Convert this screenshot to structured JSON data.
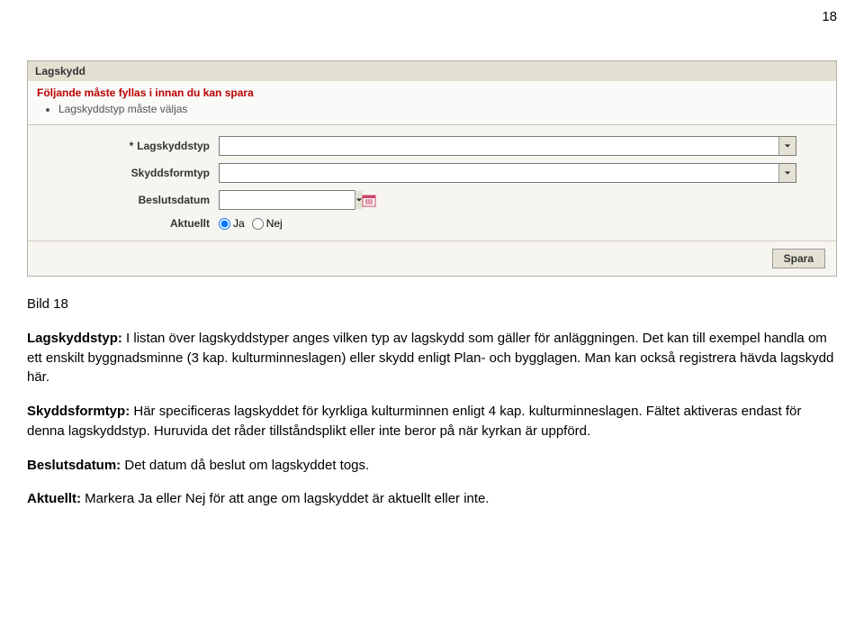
{
  "page_number": "18",
  "panel": {
    "title": "Lagskydd",
    "validation": {
      "title": "Följande måste fyllas i innan du kan spara",
      "items": [
        "Lagskyddstyp måste väljas"
      ]
    },
    "fields": {
      "lagskyddstyp": {
        "label": "Lagskyddstyp",
        "required": "*",
        "value": ""
      },
      "skyddsformtyp": {
        "label": "Skyddsformtyp",
        "value": ""
      },
      "beslutsdatum": {
        "label": "Beslutsdatum",
        "value": ""
      },
      "aktuellt": {
        "label": "Aktuellt",
        "ja": "Ja",
        "nej": "Nej"
      }
    },
    "save": "Spara"
  },
  "body": {
    "caption": "Bild 18",
    "p1_label": "Lagskyddstyp:",
    "p1_text": " I listan över lagskyddstyper anges vilken typ av lagskydd som gäller för anläggningen. Det kan till exempel handla om ett enskilt byggnadsminne (3 kap. kulturminneslagen) eller skydd enligt Plan- och bygglagen. Man kan också registrera hävda lagskydd här.",
    "p2_label": "Skyddsformtyp:",
    "p2_text": " Här specificeras lagskyddet för kyrkliga kulturminnen enligt 4 kap. kulturminneslagen. Fältet aktiveras endast för denna lagskyddstyp. Huruvida det råder tillståndsplikt eller inte beror på när kyrkan är uppförd.",
    "p3_label": "Beslutsdatum:",
    "p3_text": " Det datum då beslut om lagskyddet togs.",
    "p4_label": "Aktuellt:",
    "p4_text": " Markera Ja eller Nej för att ange om lagskyddet är aktuellt eller inte."
  }
}
